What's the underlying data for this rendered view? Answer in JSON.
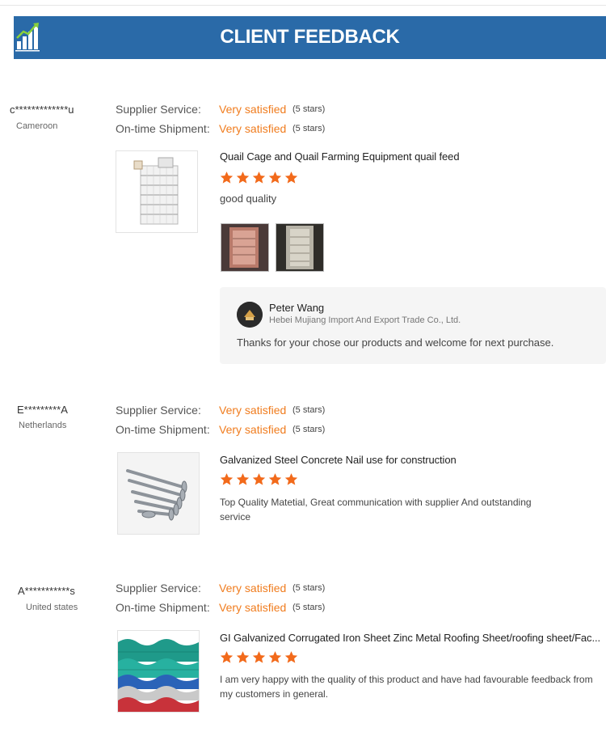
{
  "header": {
    "title": "CLIENT FEEDBACK",
    "icon": "bar-chart-growth-icon"
  },
  "colors": {
    "banner": "#2a6aa8",
    "accent": "#f07c1e",
    "star": "#f26a1b"
  },
  "reviews": [
    {
      "buyer": "c*************u",
      "country": "Cameroon",
      "ratings": [
        {
          "label": "Supplier Service:",
          "value": "Very satisfied",
          "stars": "(5 stars)"
        },
        {
          "label": "On-time Shipment:",
          "value": "Very satisfied",
          "stars": "(5 stars)"
        }
      ],
      "product_title": "Quail Cage and Quail Farming Equipment quail feed",
      "star_rating": 5,
      "comment": "good quality",
      "product_image": "quail-cage-image",
      "photos": [
        "review-photo-1",
        "review-photo-2"
      ],
      "reply": {
        "name": "Peter Wang",
        "company": "Hebei Mujiang Import And Export Trade Co., Ltd.",
        "text": "Thanks for your chose our products and welcome for next purchase."
      }
    },
    {
      "buyer": "E*********A",
      "country": "Netherlands",
      "ratings": [
        {
          "label": "Supplier Service:",
          "value": "Very satisfied",
          "stars": "(5 stars)"
        },
        {
          "label": "On-time Shipment:",
          "value": "Very satisfied",
          "stars": "(5 stars)"
        }
      ],
      "product_title": "Galvanized Steel Concrete Nail use for construction",
      "star_rating": 5,
      "comment": "Top Quality Matetial, Great communication with supplier And outstanding service",
      "product_image": "concrete-nails-image"
    },
    {
      "buyer": "A***********s",
      "country": "United states",
      "ratings": [
        {
          "label": "Supplier Service:",
          "value": "Very satisfied",
          "stars": "(5 stars)"
        },
        {
          "label": "On-time Shipment:",
          "value": "Very satisfied",
          "stars": "(5 stars)"
        }
      ],
      "product_title": "GI Galvanized Corrugated Iron Sheet Zinc Metal Roofing Sheet/roofing sheet/Fac...",
      "star_rating": 5,
      "comment": "I am very happy with the quality of this product and have had favourable feedback from my customers in general.",
      "product_image": "roofing-sheet-image"
    }
  ]
}
